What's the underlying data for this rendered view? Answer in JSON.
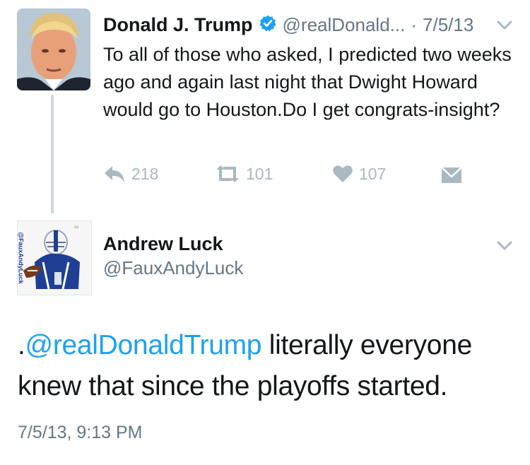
{
  "parent_tweet": {
    "author_name": "Donald J. Trump",
    "handle": "@realDonald...",
    "separator": " · ",
    "date": "7/5/13",
    "text": "To all of those who asked, I predicted two weeks ago and again last night that Dwight Howard would go to Houston.Do I get congrats-insight?",
    "reply_count": "218",
    "retweet_count": "101",
    "like_count": "107"
  },
  "reply_tweet": {
    "author_name": "Andrew Luck",
    "handle": "@FauxAndyLuck",
    "avatar_watermark": "@FauxAndyLuck",
    "text_prefix": ".",
    "mention": "@realDonaldTrump",
    "text_rest": " literally everyone knew that since the playoffs started.",
    "timestamp": "7/5/13, 9:13 PM"
  },
  "colors": {
    "link": "#1da1f2",
    "muted": "#657786",
    "icon": "#aab8c2",
    "verified": "#1da1f2"
  },
  "icons": [
    "reply-icon",
    "retweet-icon",
    "like-icon",
    "direct-message-icon",
    "chevron-down-icon",
    "verified-badge-icon"
  ]
}
